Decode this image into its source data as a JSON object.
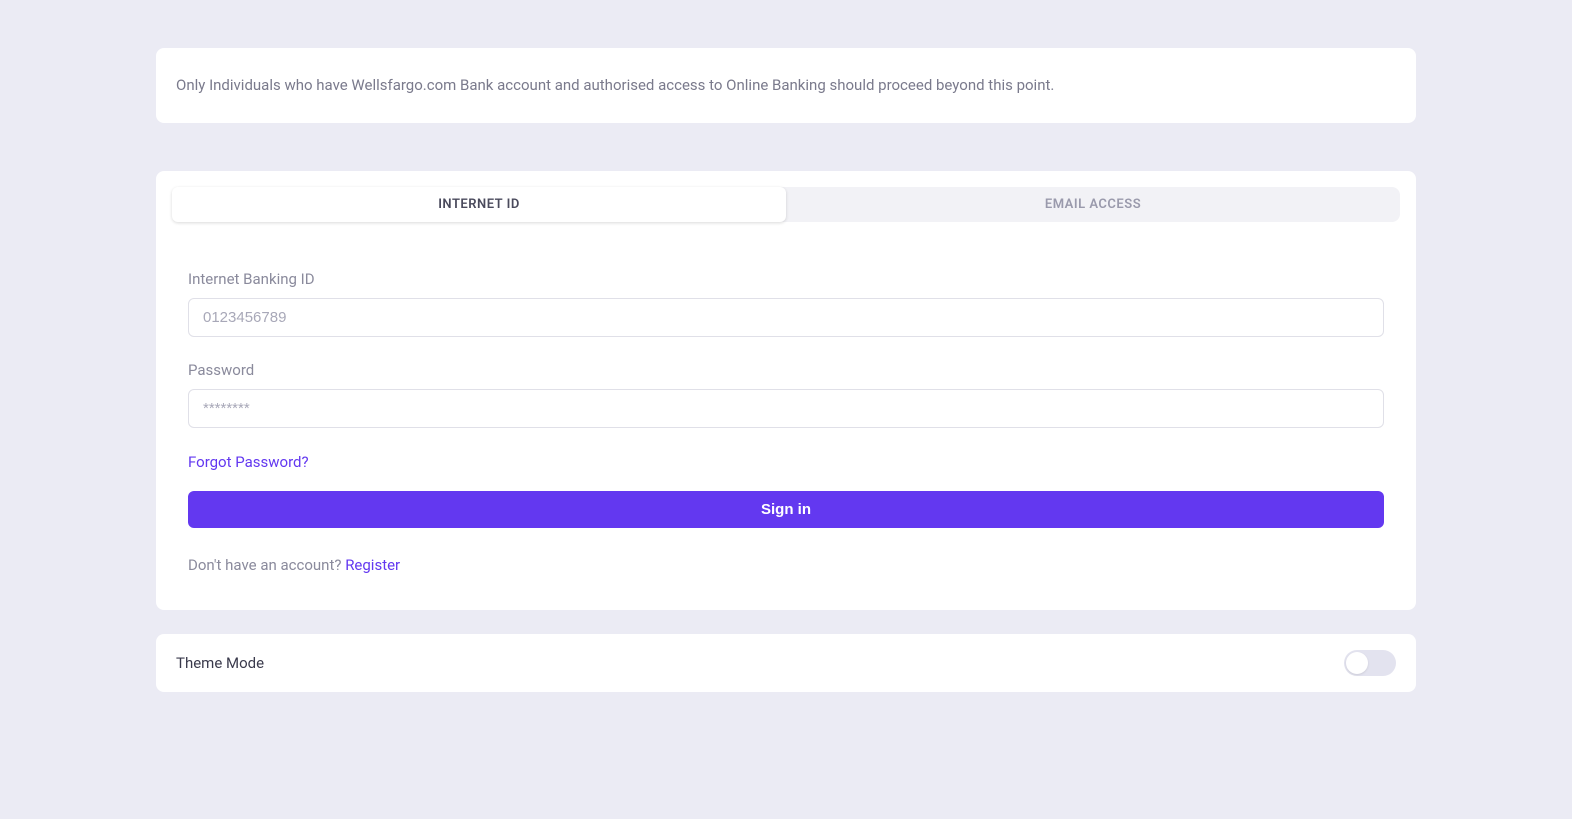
{
  "notice": {
    "text": "Only Individuals who have Wellsfargo.com Bank account and authorised access to Online Banking should proceed beyond this point."
  },
  "tabs": {
    "internetId": "INTERNET ID",
    "emailAccess": "EMAIL ACCESS"
  },
  "form": {
    "idLabel": "Internet Banking ID",
    "idPlaceholder": "0123456789",
    "passwordLabel": "Password",
    "passwordPlaceholder": "********",
    "forgotPassword": "Forgot Password?",
    "signInButton": "Sign in",
    "noAccountText": "Don't have an account? ",
    "registerLink": "Register"
  },
  "theme": {
    "label": "Theme Mode"
  }
}
